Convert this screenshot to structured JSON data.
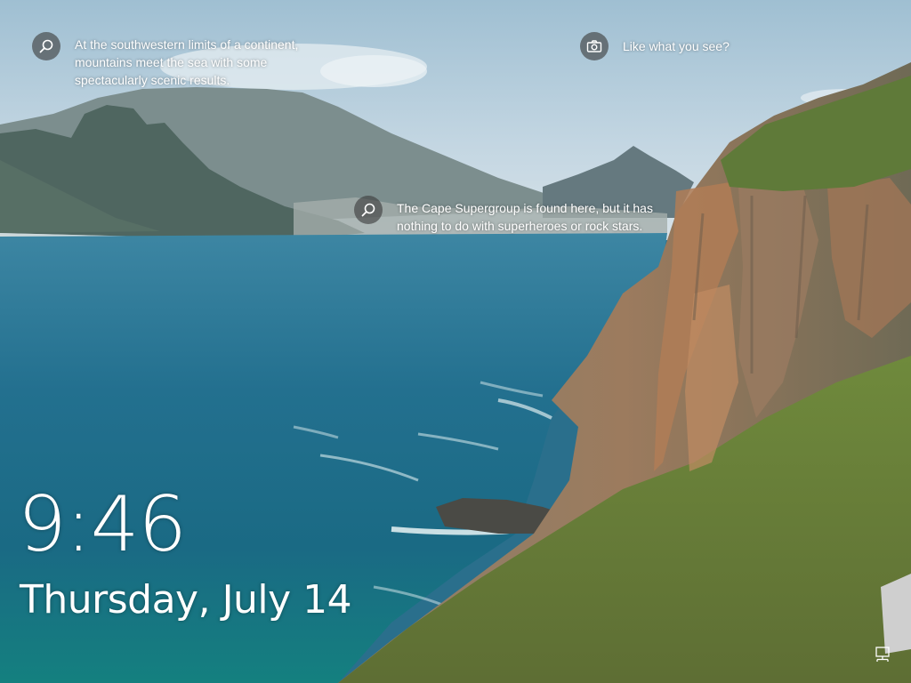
{
  "spotlight": {
    "hotspot_1": {
      "icon": "magnifier-icon",
      "text": "At the southwestern limits of a continent, mountains meet the sea with some spectacularly scenic results."
    },
    "hotspot_2": {
      "icon": "magnifier-icon",
      "text": "The Cape Supergroup is found here, but it has nothing to do with superheroes or rock stars."
    },
    "feedback": {
      "icon": "camera-icon",
      "text": "Like what you see?"
    }
  },
  "clock": {
    "time": "9:46",
    "date": "Thursday, July 14"
  },
  "system_tray": {
    "network_icon": "network-icon"
  },
  "colors": {
    "text": "#ffffff",
    "icon_circle": "#3c3c3c",
    "sea": "#1f7592",
    "sky": "#b7cfdd"
  }
}
